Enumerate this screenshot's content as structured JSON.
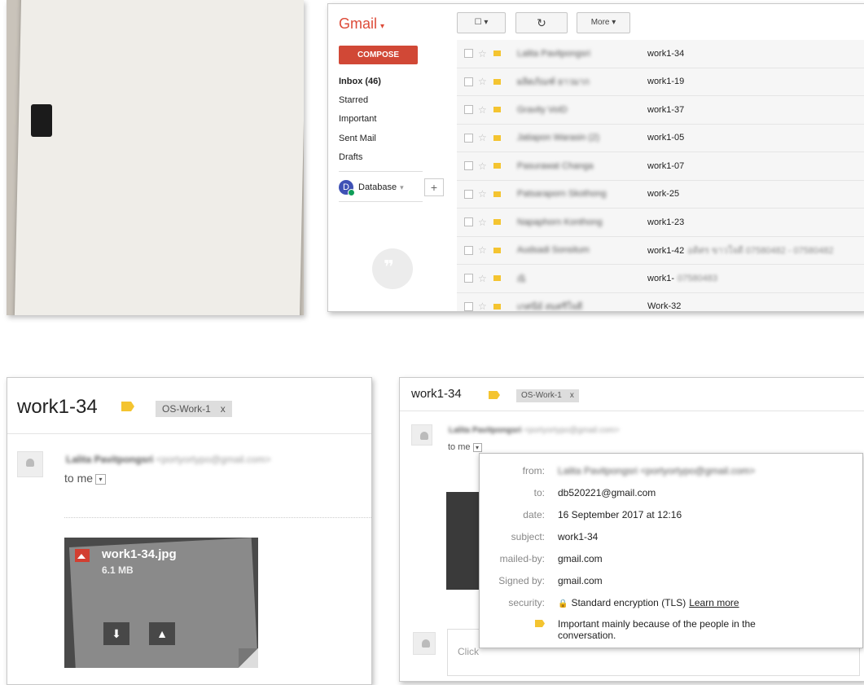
{
  "inbox": {
    "brand": "Gmail",
    "refresh_icon": "refresh-icon",
    "more_label": "More",
    "compose_label": "COMPOSE",
    "nav": {
      "inbox": "Inbox (46)",
      "starred": "Starred",
      "important": "Important",
      "sent": "Sent Mail",
      "drafts": "Drafts"
    },
    "account": {
      "initial": "D",
      "name": "Database"
    },
    "plus_label": "+",
    "rows": [
      {
        "sender": "Lalita Pavitpongsri",
        "subject": "work1-34",
        "extra": ""
      },
      {
        "sender": "ผลิตภัณฑ์ ยาวมาก",
        "subject": "work1-19",
        "extra": ""
      },
      {
        "sender": "Gravity VoID",
        "subject": "work1-37",
        "extra": ""
      },
      {
        "sender": "Jatiapon Warasin (2)",
        "subject": "work1-05",
        "extra": ""
      },
      {
        "sender": "Pasurawat Changa",
        "subject": "work1-07",
        "extra": ""
      },
      {
        "sender": "Patsaraporn Skothong",
        "subject": "work-25",
        "extra": ""
      },
      {
        "sender": "Napaphorn Konthong",
        "subject": "work1-23",
        "extra": ""
      },
      {
        "sender": "Audsadi Sonsitum",
        "subject": "work1-42",
        "extra": "อดิศร ขาวใจดี 07580482 - 07580482"
      },
      {
        "sender": "ณิ",
        "subject": "work1-",
        "extra": "07580483"
      },
      {
        "sender": "เกศนีย์ สมศรีใจดี",
        "subject": "Work-32",
        "extra": ""
      }
    ]
  },
  "email1": {
    "title": "work1-34",
    "chip_label": "OS-Work-1",
    "chip_close": "x",
    "sender_name": "Lalita Pavitpongsri",
    "sender_email": "<portyortypo@gmail.com>",
    "to_me": "to me",
    "attachment": {
      "name": "work1-34.jpg",
      "size": "6.1 MB"
    }
  },
  "email2": {
    "title": "work1-34",
    "chip_label": "OS-Work-1",
    "chip_close": "x",
    "sender_name": "Lalita Pavitpongsri",
    "sender_email": "<portyortypo@gmail.com>",
    "to_me": "to me",
    "reply_placeholder": "Click",
    "details": {
      "from_k": "from:",
      "from_v": "Lalita Pavitpongsri <portyortypo@gmail.com>",
      "to_k": "to:",
      "to_v": "db520221@gmail.com",
      "date_k": "date:",
      "date_v": "16 September 2017 at 12:16",
      "subject_k": "subject:",
      "subject_v": "work1-34",
      "mailedby_k": "mailed-by:",
      "mailedby_v": "gmail.com",
      "signedby_k": "Signed by:",
      "signedby_v": "gmail.com",
      "security_k": "security:",
      "security_v": "Standard encryption (TLS)",
      "learn_more": "Learn more",
      "important_v1": "Important mainly because of the people in the",
      "important_v2": "conversation."
    }
  },
  "colors": {
    "gmail_red": "#dd4b39",
    "compose_red": "#d14836",
    "label_yellow": "#f4c430"
  }
}
